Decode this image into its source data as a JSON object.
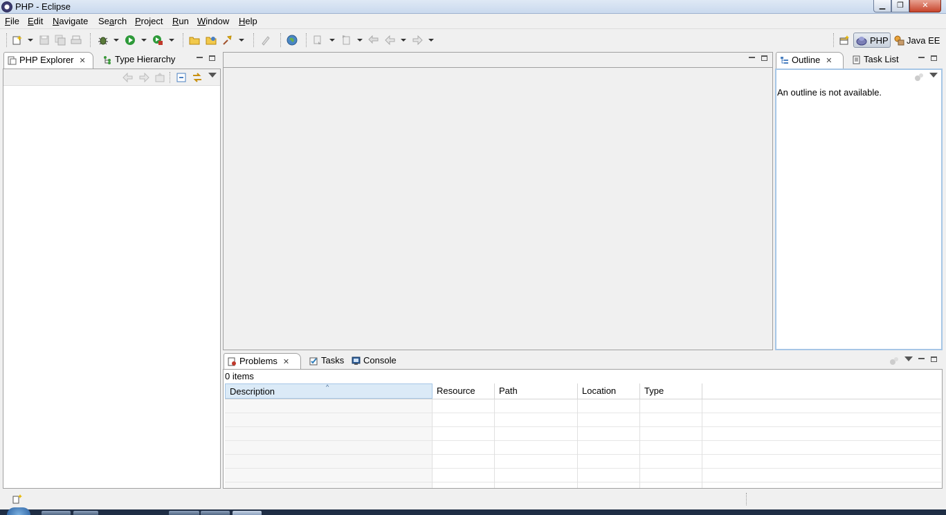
{
  "window": {
    "title": "PHP - Eclipse",
    "controls": [
      "minimize",
      "maximize",
      "close"
    ]
  },
  "menubar": {
    "items": [
      {
        "label": "File",
        "mnemonic": "F",
        "rest": "ile"
      },
      {
        "label": "Edit",
        "mnemonic": "E",
        "rest": "dit"
      },
      {
        "label": "Navigate",
        "mnemonic": "N",
        "rest": "avigate"
      },
      {
        "label": "Search",
        "mnemonic": "a",
        "pre": "Se",
        "rest": "rch"
      },
      {
        "label": "Project",
        "mnemonic": "P",
        "rest": "roject"
      },
      {
        "label": "Run",
        "mnemonic": "R",
        "rest": "un"
      },
      {
        "label": "Window",
        "mnemonic": "W",
        "rest": "indow"
      },
      {
        "label": "Help",
        "mnemonic": "H",
        "rest": "elp"
      }
    ]
  },
  "toolbar": {
    "icons": [
      "new-wizard-icon",
      "save-icon",
      "save-all-icon",
      "print-icon",
      "debug-icon",
      "run-icon",
      "external-tools-icon",
      "open-type-icon",
      "open-resource-icon",
      "search-icon",
      "toggle-mark-occurrences-icon",
      "browser-icon",
      "next-annotation-icon",
      "previous-annotation-icon",
      "last-edit-location-icon",
      "back-icon",
      "forward-icon"
    ]
  },
  "perspectives": {
    "items": [
      {
        "label": "PHP",
        "active": true
      },
      {
        "label": "Java EE",
        "active": false
      }
    ]
  },
  "left_view": {
    "tabs": [
      {
        "label": "PHP Explorer",
        "active": true
      },
      {
        "label": "Type Hierarchy",
        "active": false
      }
    ]
  },
  "right_view": {
    "tabs": [
      {
        "label": "Outline",
        "active": true
      },
      {
        "label": "Task List",
        "active": false
      }
    ],
    "message": "An outline is not available."
  },
  "bottom_view": {
    "tabs": [
      {
        "label": "Problems",
        "active": true
      },
      {
        "label": "Tasks",
        "active": false
      },
      {
        "label": "Console",
        "active": false
      }
    ],
    "item_count": "0 items",
    "columns": [
      "Description",
      "Resource",
      "Path",
      "Location",
      "Type"
    ],
    "sorted_column": "Description"
  },
  "colors": {
    "titlebar": "#c9d9ee",
    "background": "#f0f0f0",
    "border": "#a0a0a0",
    "selected_header": "#dbeaf7"
  }
}
